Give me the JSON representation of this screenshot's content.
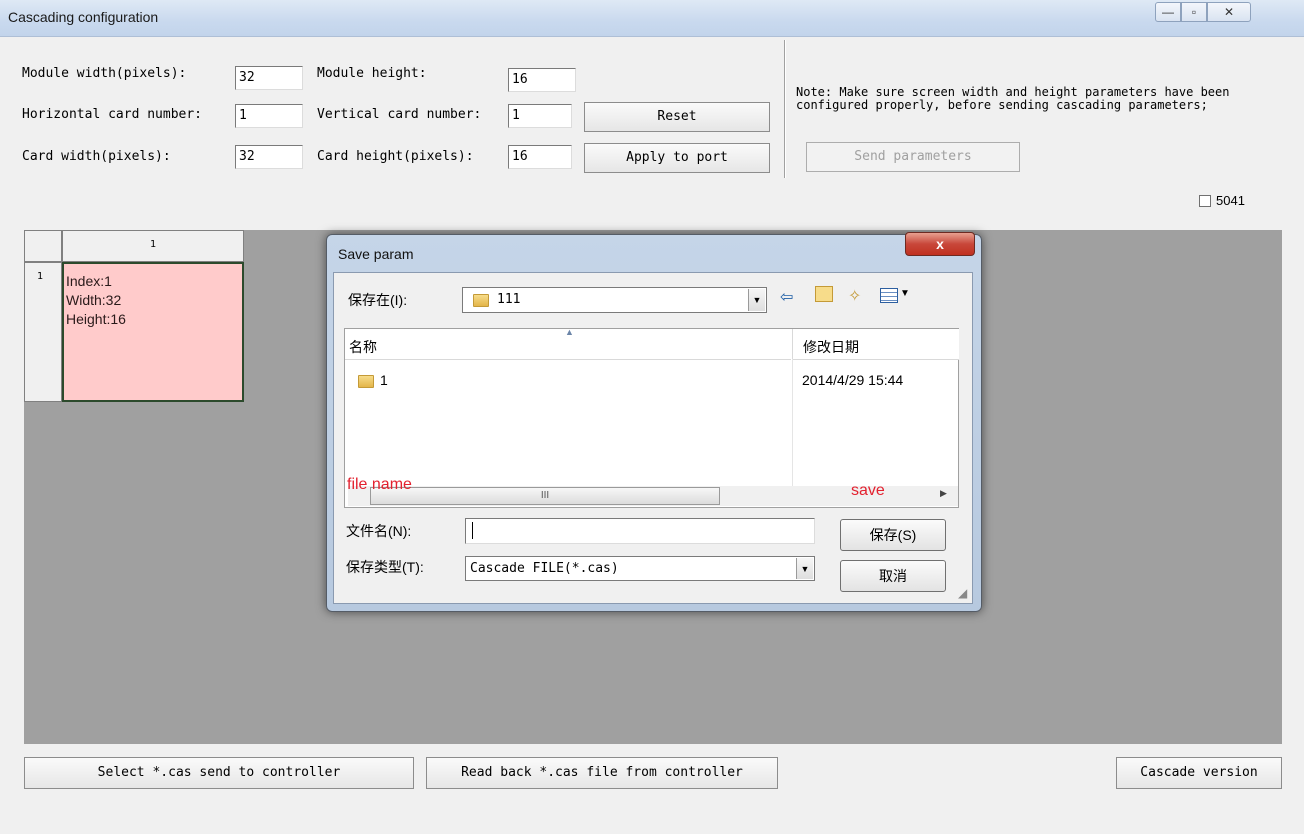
{
  "window": {
    "title": "Cascading configuration",
    "minimize": "—",
    "maximize": "▫",
    "close": "✕"
  },
  "form": {
    "module_width_label": "Module width(pixels):",
    "module_width_value": "32",
    "module_height_label": "Module height:",
    "module_height_value": "16",
    "h_card_label": "Horizontal card number:",
    "h_card_value": "1",
    "v_card_label": "Vertical card number:",
    "v_card_value": "1",
    "card_width_label": "Card width(pixels):",
    "card_width_value": "32",
    "card_height_label": "Card height(pixels):",
    "card_height_value": "16",
    "reset_button": "Reset",
    "apply_button": "Apply to port"
  },
  "note": {
    "text": "Note: Make sure screen width and height parameters have been configured properly, before sending cascading parameters;",
    "send_button": "Send parameters",
    "checkbox_label": "5041"
  },
  "grid": {
    "col_header": "1",
    "row_header": "1",
    "card": {
      "index": "Index:1",
      "width": "Width:32",
      "height": "Height:16"
    }
  },
  "dialog": {
    "title": "Save param",
    "close_label": "x",
    "save_in_label": "保存在(I):",
    "save_in_value": "111",
    "columns": {
      "name": "名称",
      "modified": "修改日期"
    },
    "items": [
      {
        "name": "1",
        "modified": "2014/4/29 15:44"
      }
    ],
    "scroll_thumb": "III",
    "annotation_file_name": "file name",
    "annotation_save": "save",
    "filename_label": "文件名(N):",
    "filename_value": "",
    "filetype_label": "保存类型(T):",
    "filetype_value": "Cascade FILE(*.cas)",
    "save_button": "保存(S)",
    "cancel_button": "取消"
  },
  "footer": {
    "select_send_button": "Select *.cas send to controller",
    "read_back_button": "Read back *.cas file from controller",
    "version_button": "Cascade version"
  }
}
